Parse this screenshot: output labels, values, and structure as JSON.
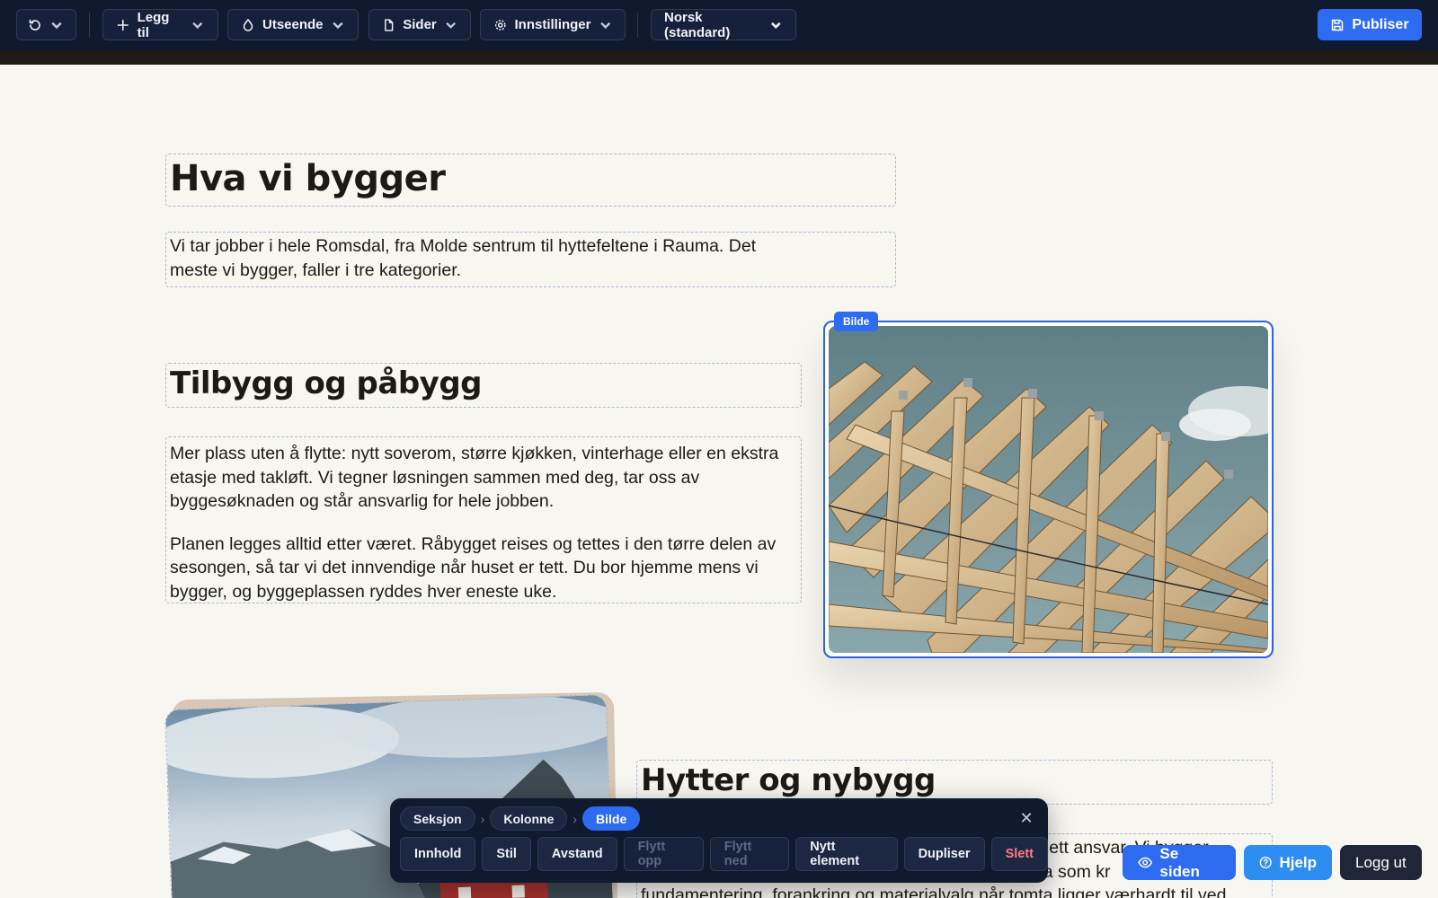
{
  "toolbar": {
    "undo_icon": "history-icon",
    "add_label": "Legg til",
    "appearance_label": "Utseende",
    "pages_label": "Sider",
    "settings_label": "Innstillinger",
    "language_value": "Norsk (standard)",
    "publish_label": "Publiser"
  },
  "content": {
    "heading": "Hva vi bygger",
    "intro": "Vi tar jobber i hele Romsdal, fra Molde sentrum til hyttefeltene i Rauma. Det meste vi bygger, faller i tre kategorier.",
    "section1": {
      "title": "Tilbygg og påbygg",
      "p1": "Mer plass uten å flytte: nytt soverom, større kjøkken, vinterhage eller en ekstra etasje med takløft. Vi tegner løsningen sammen med deg, tar oss av byggesøknaden og står ansvarlig for hele jobben.",
      "p2": "Planen legges alltid etter været. Råbygget reises og tettes i den tørre delen av sesongen, så tar vi det innvendige når huset er tett. Du bor hjemme mens vi bygger, og byggeplassen ryddes hver eneste uke.",
      "image_tag": "Bilde"
    },
    "section2": {
      "title": "Hytter og nybygg",
      "text_line1": "g ett ansvar. Vi bygger",
      "text_line2": "va som kr",
      "text_line3": "fundamentering, forankring og materialvalg når tomta ligger værhardt til ved"
    }
  },
  "selection_bar": {
    "breadcrumbs": [
      "Seksjon",
      "Kolonne",
      "Bilde"
    ],
    "actions": [
      "Innhold",
      "Stil",
      "Avstand",
      "Flytt opp",
      "Flytt ned",
      "Nytt element",
      "Dupliser",
      "Slett"
    ]
  },
  "floating": {
    "view_label": "Se siden",
    "help_label": "Hjelp",
    "logout_label": "Logg ut"
  },
  "colors": {
    "toolbar_bg": "#0f1a2e",
    "accent": "#2d6bf0",
    "page_bg": "#f8f6f1",
    "danger": "#ff7c86"
  }
}
